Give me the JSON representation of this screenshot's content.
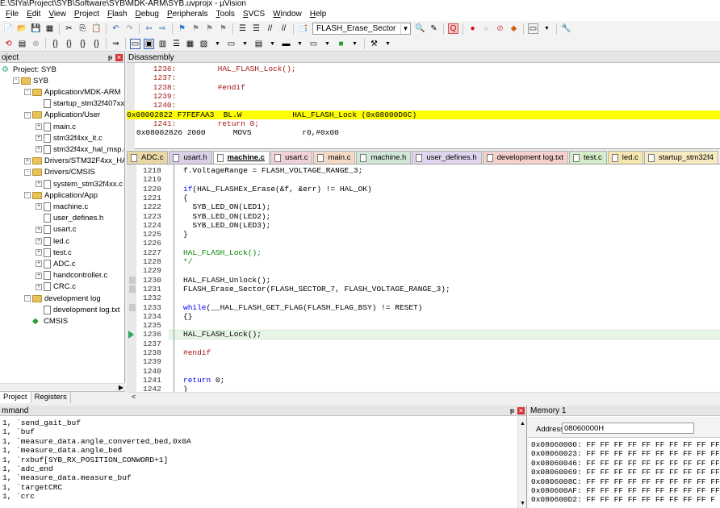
{
  "title": "E:\\SIYa\\Project\\SYB\\Software\\SYB\\MDK-ARM\\SYB.uvprojx - µVision",
  "menu": [
    "File",
    "Edit",
    "View",
    "Project",
    "Flash",
    "Debug",
    "Peripherals",
    "Tools",
    "SVCS",
    "Window",
    "Help"
  ],
  "toolbar": {
    "target_combo": "FLASH_Erase_Sector"
  },
  "project_panel": {
    "title": "oject",
    "tree": [
      {
        "label": "Project: SYB",
        "indent": 0,
        "kind": "proj"
      },
      {
        "label": "SYB",
        "indent": 1,
        "kind": "folder",
        "pm": "-"
      },
      {
        "label": "Application/MDK-ARM",
        "indent": 2,
        "kind": "folder",
        "pm": "-"
      },
      {
        "label": "startup_stm32f407xx.s",
        "indent": 3,
        "kind": "file"
      },
      {
        "label": "Application/User",
        "indent": 2,
        "kind": "folder",
        "pm": "-"
      },
      {
        "label": "main.c",
        "indent": 3,
        "kind": "file",
        "pm": "+"
      },
      {
        "label": "stm32f4xx_it.c",
        "indent": 3,
        "kind": "file",
        "pm": "+"
      },
      {
        "label": "stm32f4xx_hal_msp.c",
        "indent": 3,
        "kind": "file",
        "pm": "+"
      },
      {
        "label": "Drivers/STM32F4xx_HAL_Driv",
        "indent": 2,
        "kind": "folder",
        "pm": "+"
      },
      {
        "label": "Drivers/CMSIS",
        "indent": 2,
        "kind": "folder",
        "pm": "-"
      },
      {
        "label": "system_stm32f4xx.c",
        "indent": 3,
        "kind": "file",
        "pm": "+"
      },
      {
        "label": "Application/App",
        "indent": 2,
        "kind": "folder",
        "pm": "-"
      },
      {
        "label": "machine.c",
        "indent": 3,
        "kind": "file",
        "pm": "+"
      },
      {
        "label": "user_defines.h",
        "indent": 3,
        "kind": "file"
      },
      {
        "label": "usart.c",
        "indent": 3,
        "kind": "file",
        "pm": "+"
      },
      {
        "label": "led.c",
        "indent": 3,
        "kind": "file",
        "pm": "+"
      },
      {
        "label": "test.c",
        "indent": 3,
        "kind": "file",
        "pm": "+"
      },
      {
        "label": "ADC.c",
        "indent": 3,
        "kind": "file",
        "pm": "+"
      },
      {
        "label": "handcontroller.c",
        "indent": 3,
        "kind": "file",
        "pm": "+"
      },
      {
        "label": "CRC.c",
        "indent": 3,
        "kind": "file",
        "pm": "+"
      },
      {
        "label": "development log",
        "indent": 2,
        "kind": "folder",
        "pm": "-"
      },
      {
        "label": "development log.txt",
        "indent": 3,
        "kind": "file"
      },
      {
        "label": "CMSIS",
        "indent": 2,
        "kind": "cmsis"
      }
    ],
    "tabs": [
      "Project",
      "Registers"
    ]
  },
  "disassembly": {
    "title": "Disassembly",
    "lines": [
      {
        "text": "    1236:         HAL_FLASH_Lock();",
        "kind": "src"
      },
      {
        "text": "    1237:",
        "kind": "src"
      },
      {
        "text": "    1238:         #endif",
        "kind": "src"
      },
      {
        "text": "    1239:",
        "kind": "src"
      },
      {
        "text": "    1240:",
        "kind": "src"
      },
      {
        "text": "0x08002822 F7FEFAA3  BL.W           HAL_FLASH_Lock (0x08000D6C)",
        "kind": "hl"
      },
      {
        "text": "    1241:         return 0;",
        "kind": "src"
      },
      {
        "text": "0x08002826 2000      MOVS           r0,#0x00",
        "kind": "asm"
      }
    ]
  },
  "editor_tabs": [
    {
      "label": "ADC.c",
      "color": "#e9d7a6"
    },
    {
      "label": "usart.h",
      "color": "#d9d0e6"
    },
    {
      "label": "machine.c",
      "color": "#cfe0f1",
      "active": true
    },
    {
      "label": "usart.c",
      "color": "#f1d1d8"
    },
    {
      "label": "main.c",
      "color": "#f4d9c4"
    },
    {
      "label": "machine.h",
      "color": "#cfe6d9"
    },
    {
      "label": "user_defines.h",
      "color": "#e0d5ef"
    },
    {
      "label": "development log.txt",
      "color": "#f6d0cc"
    },
    {
      "label": "test.c",
      "color": "#d3ecc9"
    },
    {
      "label": "led.c",
      "color": "#f5e6b0"
    },
    {
      "label": "startup_stm32f4",
      "color": "#f7ebc2"
    }
  ],
  "editor": {
    "lines": [
      {
        "n": "1218",
        "code": [
          [
            "",
            "f.VoltageRange = FLASH_VOLTAGE_RANGE_3;"
          ]
        ]
      },
      {
        "n": "1219",
        "code": []
      },
      {
        "n": "1220",
        "code": [
          [
            "kw",
            "if"
          ],
          [
            "",
            "(HAL_FLASHEx_Erase(&f, &err) != HAL_OK)"
          ]
        ]
      },
      {
        "n": "1221",
        "code": [
          [
            "",
            "{"
          ]
        ]
      },
      {
        "n": "1222",
        "code": [
          [
            "",
            "  SYB_LED_ON(LED1);"
          ]
        ]
      },
      {
        "n": "1223",
        "code": [
          [
            "",
            "  SYB_LED_ON(LED2);"
          ]
        ]
      },
      {
        "n": "1224",
        "code": [
          [
            "",
            "  SYB_LED_ON(LED3);"
          ]
        ]
      },
      {
        "n": "1225",
        "code": [
          [
            "",
            "}"
          ]
        ]
      },
      {
        "n": "1226",
        "code": []
      },
      {
        "n": "1227",
        "code": [
          [
            "cm",
            "HAL_FLASH_Lock();"
          ]
        ]
      },
      {
        "n": "1228",
        "code": [
          [
            "cm",
            "*/"
          ]
        ]
      },
      {
        "n": "1229",
        "code": []
      },
      {
        "n": "1230",
        "code": [
          [
            "",
            "HAL_FLASH_Unlock();"
          ]
        ],
        "bp": true
      },
      {
        "n": "1231",
        "code": [
          [
            "",
            "FLASH_Erase_Sector(FLASH_SECTOR_7, FLASH_VOLTAGE_RANGE_3);"
          ]
        ],
        "bp": true
      },
      {
        "n": "1232",
        "code": []
      },
      {
        "n": "1233",
        "code": [
          [
            "kw",
            "while"
          ],
          [
            "",
            "(__HAL_FLASH_GET_FLAG(FLASH_FLAG_BSY) != RESET)"
          ]
        ],
        "bp": true
      },
      {
        "n": "1234",
        "code": [
          [
            "",
            "{}"
          ]
        ]
      },
      {
        "n": "1235",
        "code": []
      },
      {
        "n": "1236",
        "code": [
          [
            "",
            "HAL_FLASH_Lock();"
          ]
        ],
        "current": true
      },
      {
        "n": "1237",
        "code": []
      },
      {
        "n": "1238",
        "code": [
          [
            "pp",
            "#endif"
          ]
        ]
      },
      {
        "n": "1239",
        "code": []
      },
      {
        "n": "1240",
        "code": []
      },
      {
        "n": "1241",
        "code": [
          [
            "kw",
            "return"
          ],
          [
            "",
            " 0;"
          ]
        ]
      },
      {
        "n": "1242",
        "code": [
          [
            "",
            "}"
          ]
        ]
      }
    ]
  },
  "command": {
    "title": "mmand",
    "lines": [
      "1, `send_gait_buf",
      "1, `buf",
      "1, `measure_data.angle_converted_bed,0x0A",
      "1, `measure_data.angle_bed",
      "1, `rxbuf[SYB_RX_POSITION_CONWORD+1]",
      "1, `adc_end",
      "1, `measure_data.measure_buf",
      "1, `targetCRC",
      "1, `crc"
    ]
  },
  "memory": {
    "title": "Memory 1",
    "address_label": "Address:",
    "address_value": "08060000H",
    "rows": [
      "0x08060000: FF FF FF FF FF FF FF FF FF FF",
      "0x08060023: FF FF FF FF FF FF FF FF FF FF",
      "0x08060046: FF FF FF FF FF FF FF FF FF FF",
      "0x08060069: FF FF FF FF FF FF FF FF FF FF",
      "0x0806008C: FF FF FF FF FF FF FF FF FF FF",
      "0x080600AF: FF FF FF FF FF FF FF FF FF FF",
      "0x080600D2: FF FF FF FF FF FF FF FF FF F"
    ]
  }
}
